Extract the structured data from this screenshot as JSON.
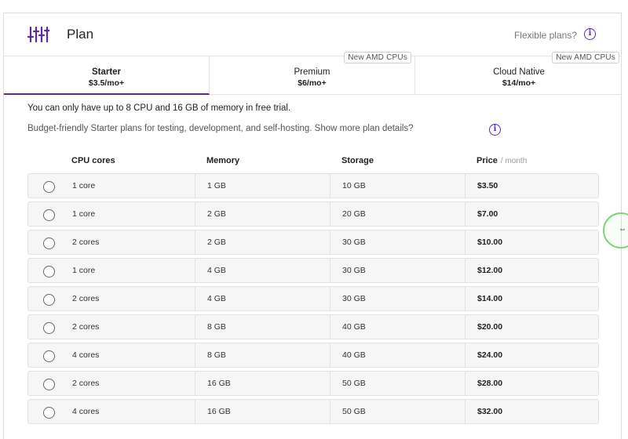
{
  "header": {
    "title": "Plan",
    "flexible_link": "Flexible plans?"
  },
  "tabs": [
    {
      "name": "Starter",
      "price": "$3.5/mo+",
      "badge": "",
      "active": true
    },
    {
      "name": "Premium",
      "price": "$6/mo+",
      "badge": "New AMD CPUs",
      "active": false
    },
    {
      "name": "Cloud Native",
      "price": "$14/mo+",
      "badge": "New AMD CPUs",
      "active": false
    }
  ],
  "notice": "You can only have up to 8 CPU and 16 GB of memory in free trial.",
  "description": "Budget-friendly Starter plans for testing, development, and self-hosting. Show more plan details?",
  "table": {
    "headers": {
      "cpu": "CPU cores",
      "memory": "Memory",
      "storage": "Storage",
      "price": "Price",
      "price_unit": "/ month"
    },
    "rows": [
      {
        "cpu": "1 core",
        "memory": "1 GB",
        "storage": "10 GB",
        "price": "$3.50"
      },
      {
        "cpu": "1 core",
        "memory": "2 GB",
        "storage": "20 GB",
        "price": "$7.00"
      },
      {
        "cpu": "2 cores",
        "memory": "2 GB",
        "storage": "30 GB",
        "price": "$10.00"
      },
      {
        "cpu": "1 core",
        "memory": "4 GB",
        "storage": "30 GB",
        "price": "$12.00"
      },
      {
        "cpu": "2 cores",
        "memory": "4 GB",
        "storage": "30 GB",
        "price": "$14.00"
      },
      {
        "cpu": "2 cores",
        "memory": "8 GB",
        "storage": "40 GB",
        "price": "$20.00"
      },
      {
        "cpu": "4 cores",
        "memory": "8 GB",
        "storage": "40 GB",
        "price": "$24.00"
      },
      {
        "cpu": "2 cores",
        "memory": "16 GB",
        "storage": "50 GB",
        "price": "$28.00"
      },
      {
        "cpu": "4 cores",
        "memory": "16 GB",
        "storage": "50 GB",
        "price": "$32.00"
      }
    ]
  },
  "colors": {
    "accent": "#5b2aa8"
  },
  "icons": {
    "plan": "sliders-icon",
    "info": "info-icon"
  }
}
